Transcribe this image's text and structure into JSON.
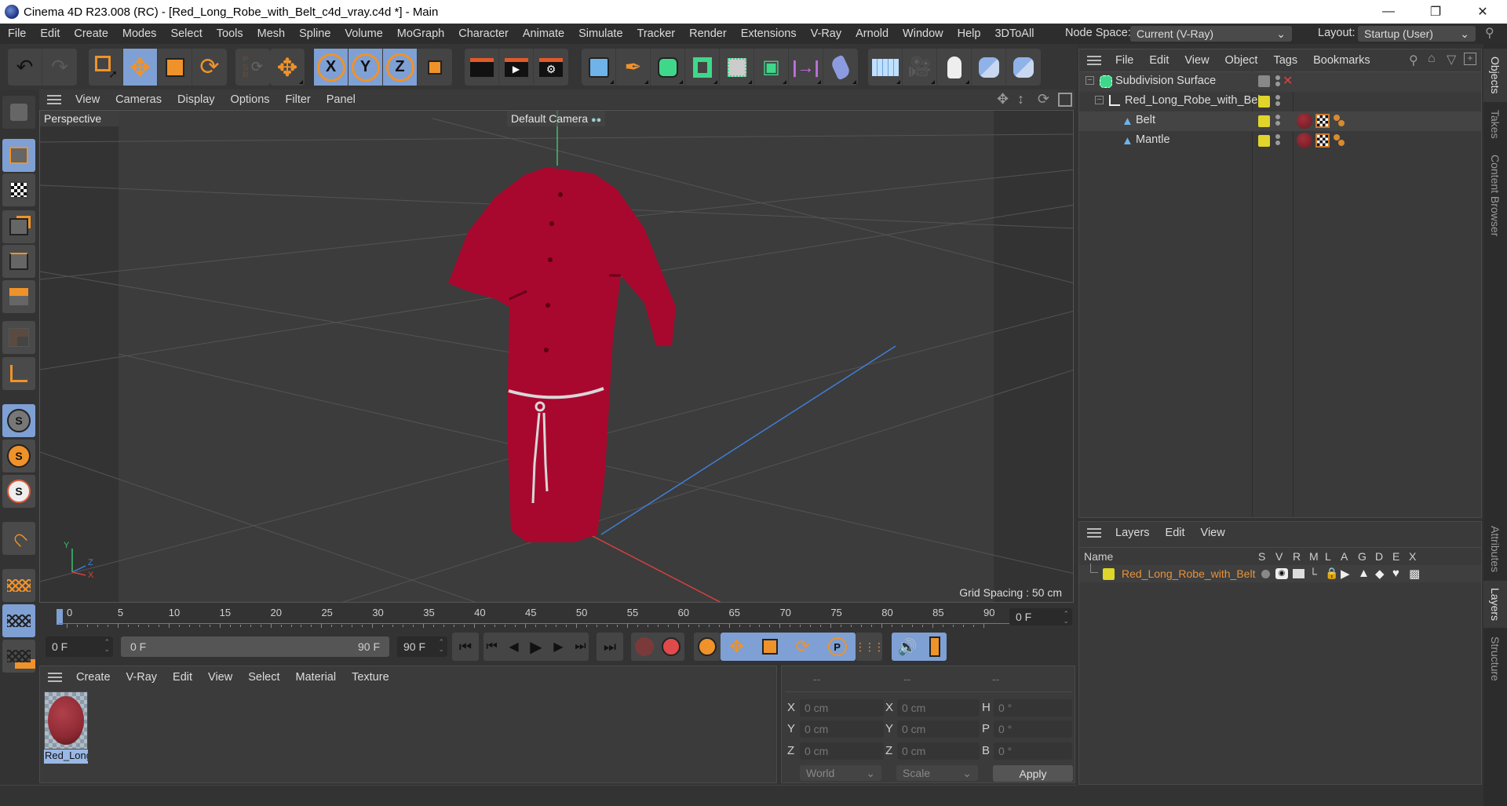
{
  "window": {
    "title": "Cinema 4D R23.008 (RC) - [Red_Long_Robe_with_Belt_c4d_vray.c4d *] - Main",
    "controls": [
      "minimize",
      "restore",
      "close"
    ]
  },
  "menubar": {
    "items": [
      "File",
      "Edit",
      "Create",
      "Modes",
      "Select",
      "Tools",
      "Mesh",
      "Spline",
      "Volume",
      "MoGraph",
      "Character",
      "Animate",
      "Simulate",
      "Tracker",
      "Render",
      "Extensions",
      "V-Ray",
      "Arnold",
      "Window",
      "Help",
      "3DToAll"
    ],
    "node_space_label": "Node Space:",
    "node_space_value": "Current (V-Ray)",
    "layout_label": "Layout:",
    "layout_value": "Startup (User)"
  },
  "toolbar": {
    "groups": [
      [
        "undo-icon",
        "redo-icon"
      ],
      [
        "live-selection-icon",
        "move-icon",
        "scale-icon",
        "rotate-icon"
      ],
      [
        "psr-lock-icon"
      ],
      [
        "move-tool-icon"
      ],
      [
        "x-axis-lock-icon",
        "y-axis-lock-icon",
        "z-axis-lock-icon",
        "coordinate-system-icon"
      ],
      [
        "render-view-icon",
        "render-picture-viewer-icon",
        "render-settings-icon"
      ],
      [
        "cube-icon",
        "pen-icon",
        "subdivision-surface-icon",
        "extrude-icon",
        "cloner-icon",
        "mograph-icon",
        "symmetry-icon",
        "bend-deformer-icon"
      ],
      [
        "floor-icon",
        "camera-icon",
        "light-icon",
        "python-icon",
        "python-2-icon"
      ]
    ],
    "active": [
      "move-icon",
      "x-axis-lock-icon",
      "y-axis-lock-icon",
      "z-axis-lock-icon"
    ]
  },
  "left_toolbar": {
    "items": [
      "make-editable-icon",
      "model-mode-icon",
      "texture-mode-icon",
      "points-mode-icon",
      "edges-mode-icon",
      "polygons-mode-icon",
      "uv-mode-icon",
      "axis-mode-icon",
      "solo-off-icon",
      "solo-single-icon",
      "solo-hierarchy-icon",
      "snap-icon",
      "workplane-icon",
      "locked-workplane-icon",
      "planar-workplane-icon"
    ]
  },
  "viewport": {
    "menu": [
      "View",
      "Cameras",
      "Display",
      "Options",
      "Filter",
      "Panel"
    ],
    "view_name": "Perspective",
    "camera": "Default Camera",
    "grid_spacing": "Grid Spacing : 50 cm",
    "axis_labels": {
      "y": "Y",
      "z": "Z",
      "x": "X"
    },
    "colors": {
      "robe": "#a8082e",
      "belt": "#d8d8d8",
      "y_axis": "#3fbf6f",
      "x_axis": "#d84040",
      "z_axis": "#3f7fd8"
    }
  },
  "timeline": {
    "ticks": [
      "0",
      "5",
      "10",
      "15",
      "20",
      "25",
      "30",
      "35",
      "40",
      "45",
      "50",
      "55",
      "60",
      "65",
      "70",
      "75",
      "80",
      "85",
      "90"
    ],
    "current_frame_field": "0 F",
    "start_field": "0 F",
    "range_start": "0 F",
    "range_end": "90 F",
    "end_field": "90 F",
    "current_marker": "0"
  },
  "playback": {
    "buttons": [
      "go-to-start",
      "previous-key",
      "previous-frame",
      "play",
      "next-frame",
      "next-key",
      "go-to-end",
      "record-keys",
      "auto-key",
      "keyframe-settings",
      "key-position",
      "key-scale",
      "key-rotation",
      "key-param",
      "key-pla",
      "sound",
      "timeline-view"
    ]
  },
  "material_manager": {
    "menu": [
      "Create",
      "V-Ray",
      "Edit",
      "View",
      "Select",
      "Material",
      "Texture"
    ],
    "materials": [
      {
        "name": "Red_Long_R",
        "color": "#8e2a34"
      }
    ]
  },
  "coordinates": {
    "headers": [
      "--",
      "--",
      "--"
    ],
    "rows": [
      {
        "l1": "X",
        "v1": "0 cm",
        "l2": "X",
        "v2": "0 cm",
        "l3": "H",
        "v3": "0 °"
      },
      {
        "l1": "Y",
        "v1": "0 cm",
        "l2": "Y",
        "v2": "0 cm",
        "l3": "P",
        "v3": "0 °"
      },
      {
        "l1": "Z",
        "v1": "0 cm",
        "l2": "Z",
        "v2": "0 cm",
        "l3": "B",
        "v3": "0 °"
      }
    ],
    "space": "World",
    "mode": "Scale",
    "apply": "Apply"
  },
  "objects_panel": {
    "menu": [
      "File",
      "Edit",
      "View",
      "Object",
      "Tags",
      "Bookmarks"
    ],
    "items": [
      {
        "name": "Subdivision Surface",
        "depth": 0,
        "icon": "subdivision-surface-icon"
      },
      {
        "name": "Red_Long_Robe_with_Belt",
        "depth": 1,
        "icon": "null-object-icon"
      },
      {
        "name": "Belt",
        "depth": 2,
        "icon": "polygon-object-icon"
      },
      {
        "name": "Mantle",
        "depth": 2,
        "icon": "polygon-object-icon"
      }
    ]
  },
  "layers_panel": {
    "menu": [
      "Layers",
      "Edit",
      "View"
    ],
    "columns": [
      "Name",
      "S",
      "V",
      "R",
      "M",
      "L",
      "A",
      "G",
      "D",
      "E",
      "X"
    ],
    "layers": [
      {
        "name": "Red_Long_Robe_with_Belt",
        "color": "#e0d52b"
      }
    ]
  },
  "right_tabs": {
    "top": [
      "Objects",
      "Takes",
      "Content Browser"
    ],
    "bottom": [
      "Attributes",
      "Layers",
      "Structure"
    ],
    "active_top": "Objects",
    "active_bottom": "Layers"
  }
}
